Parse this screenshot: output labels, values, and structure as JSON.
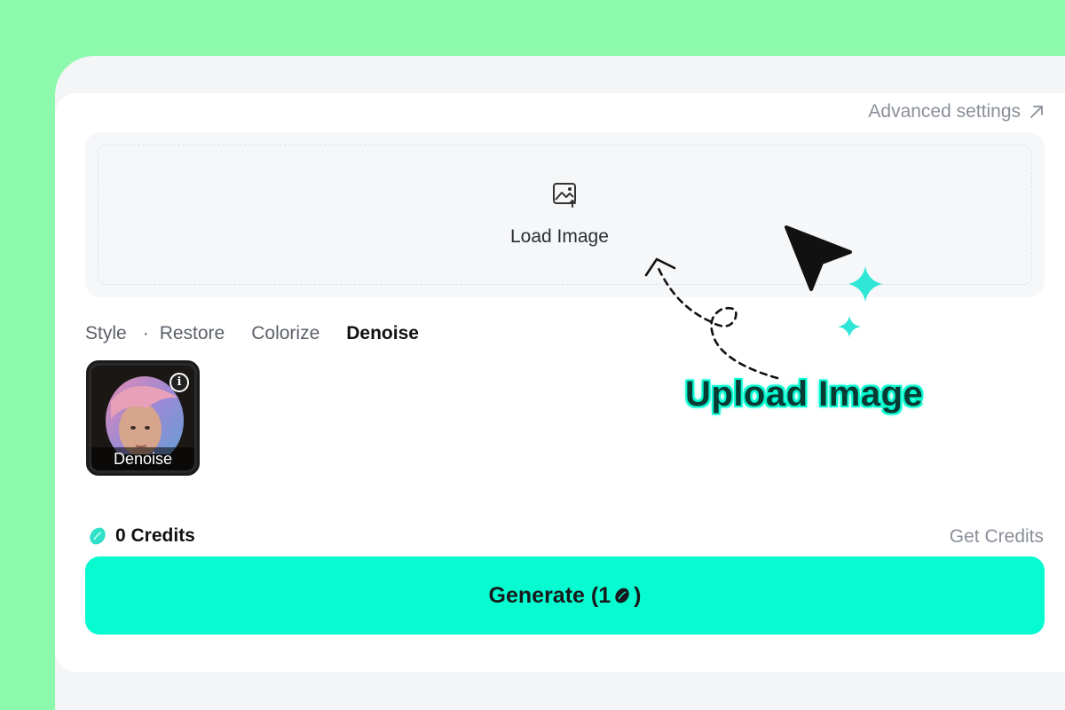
{
  "header": {
    "advanced_label": "Advanced settings"
  },
  "upload": {
    "load_label": "Load Image"
  },
  "tabs": [
    {
      "label": "Style"
    },
    {
      "label": "Restore"
    },
    {
      "label": "Colorize"
    },
    {
      "label": "Denoise",
      "active": true
    }
  ],
  "tab_separator": "·",
  "style_card": {
    "label": "Denoise",
    "info": "i"
  },
  "credits": {
    "text": "0 Credits",
    "get_label": "Get Credits"
  },
  "generate": {
    "prefix": "Generate (1",
    "suffix": ")"
  },
  "callout": {
    "text": "Upload Image"
  },
  "colors": {
    "background": "#8cf9ac",
    "accent": "#06fcd0",
    "dark": "#17191c"
  }
}
